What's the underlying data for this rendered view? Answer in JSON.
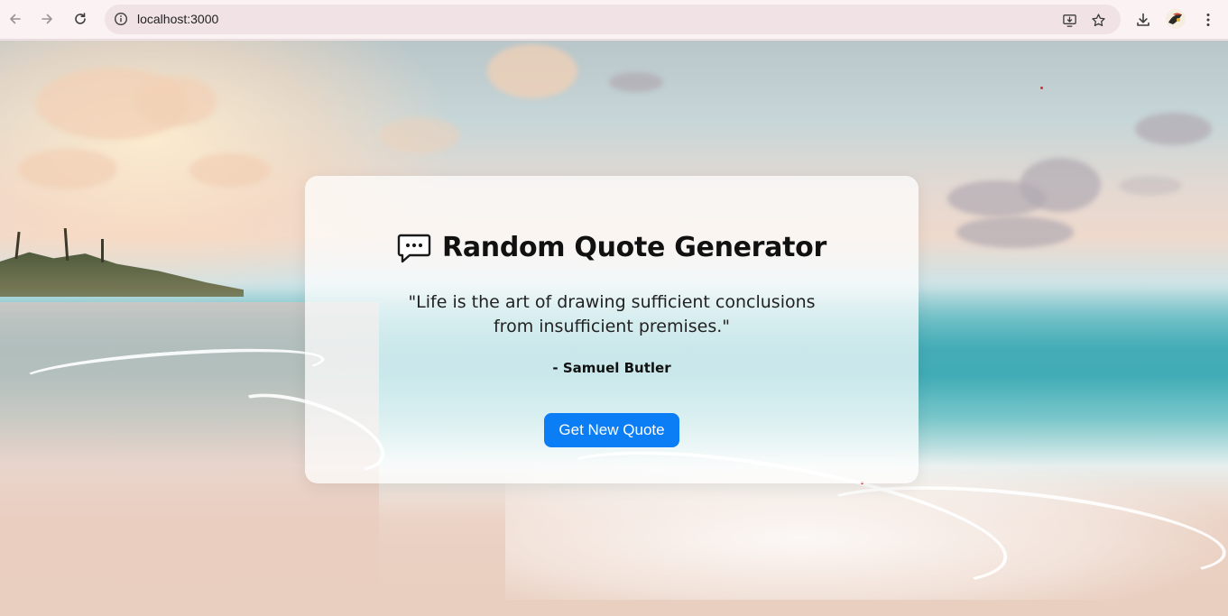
{
  "browser": {
    "url": "localhost:3000",
    "icons": {
      "back": "arrow-left-icon",
      "forward": "arrow-right-icon",
      "reload": "reload-icon",
      "site_info": "info-icon",
      "install_app": "install-app-icon",
      "bookmark": "star-icon",
      "downloads": "download-icon",
      "profile": "avatar",
      "menu": "kebab-menu-icon"
    }
  },
  "card": {
    "icon": "speech-bubble-icon",
    "title": "Random Quote Generator",
    "quote": "\"Life is the art of drawing sufficient conclusions from insufficient premises.\"",
    "author": "- Samuel Butler",
    "button_label": "Get New Quote"
  },
  "colors": {
    "button": "#0b7ef5",
    "chrome_bg": "#fbf2f3",
    "omnibox_bg": "#f1e3e5"
  }
}
